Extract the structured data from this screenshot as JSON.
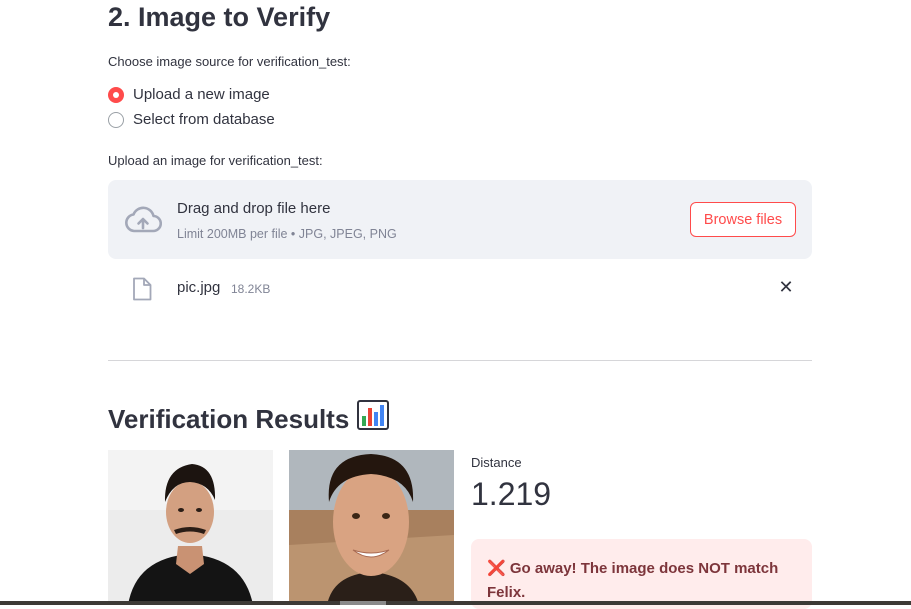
{
  "section_title": "2. Image to Verify",
  "source_label": "Choose image source for verification_test:",
  "radio_options": [
    "Upload a new image",
    "Select from database"
  ],
  "radio_selected": "Upload a new image",
  "upload_label": "Upload an image for verification_test:",
  "dropzone": {
    "title": "Drag and drop file here",
    "subtitle": "Limit 200MB per file • JPG, JPEG, PNG",
    "browse_label": "Browse files"
  },
  "uploaded_file": {
    "name": "pic.jpg",
    "size": "18.2KB"
  },
  "results_title": "Verification Results",
  "metric": {
    "label": "Distance",
    "value": "1.219"
  },
  "alert": {
    "icon": "❌",
    "message": "Go away! The image does NOT match Felix."
  },
  "colors": {
    "accent": "#ff4b4b",
    "alert_bg": "#ffecec",
    "alert_text": "#7d353b"
  }
}
